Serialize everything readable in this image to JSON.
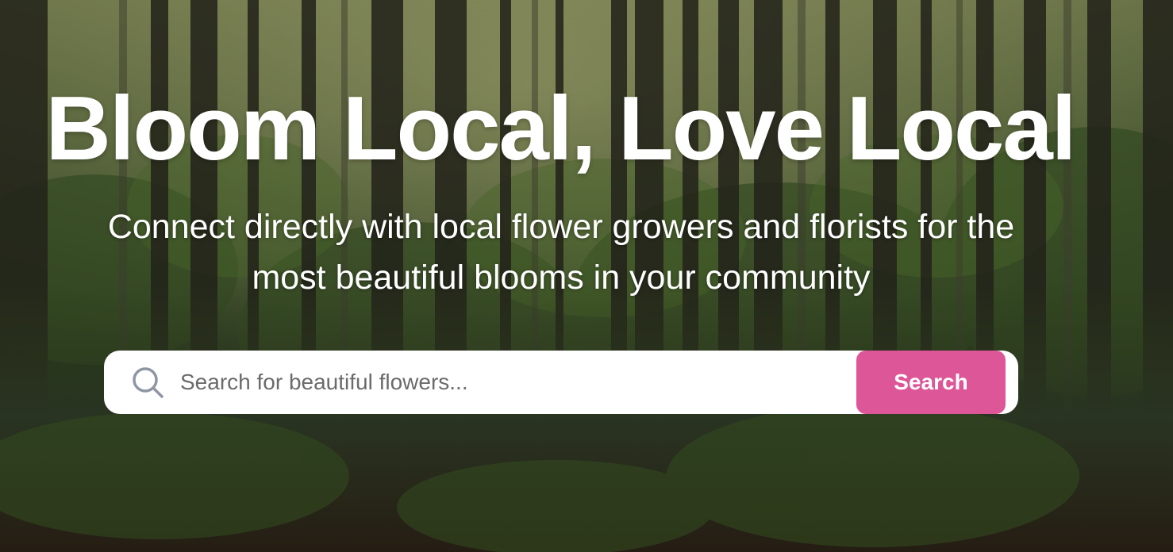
{
  "hero": {
    "title": "Bloom Local, Love Local",
    "subtitle_line1": "Connect directly with local flower growers and florists for the",
    "subtitle_line2": "most beautiful blooms in your community",
    "background": "forest-photo"
  },
  "search": {
    "icon": "search-icon",
    "placeholder": "Search for beautiful flowers...",
    "value": "",
    "button_label": "Search"
  },
  "colors": {
    "accent": "#dd5697",
    "text": "#ffffff",
    "search_bg": "#ffffff",
    "icon": "#8f96a3"
  }
}
